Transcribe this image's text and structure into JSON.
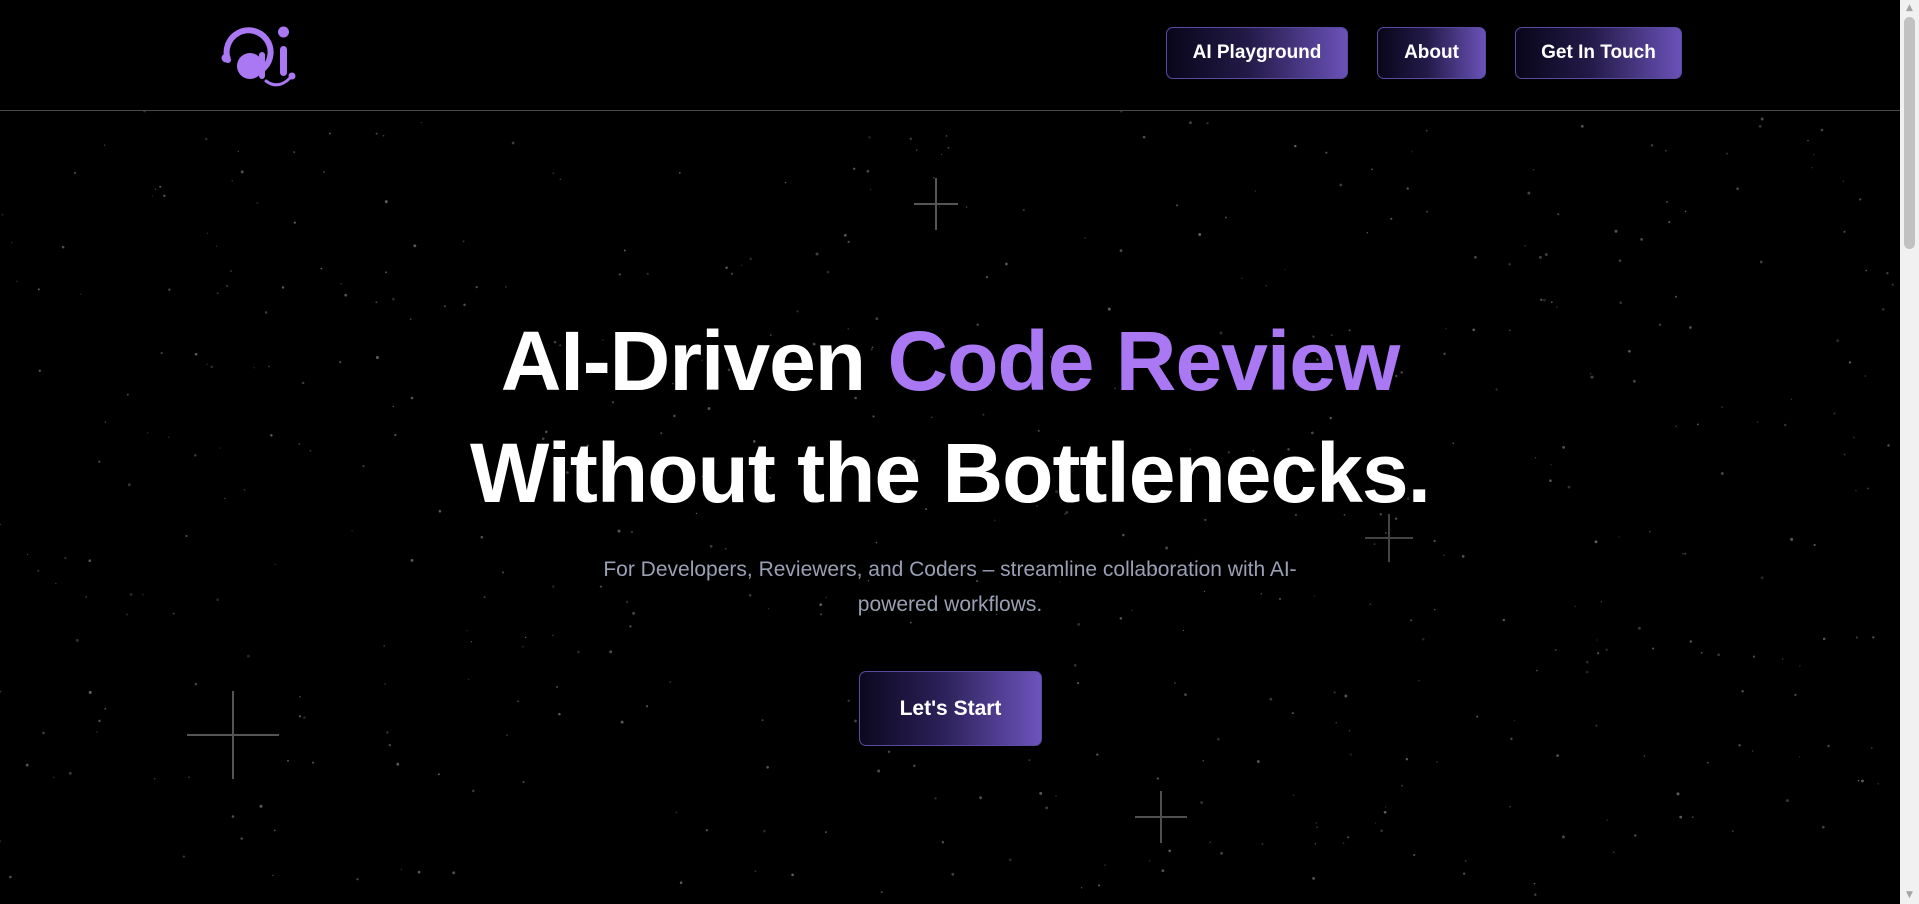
{
  "nav": {
    "logo_icon": "ai-logo-icon",
    "links": [
      {
        "label": "AI Playground"
      },
      {
        "label": "About"
      },
      {
        "label": "Get In Touch"
      }
    ]
  },
  "hero": {
    "title_part1": "AI-Driven ",
    "title_accent": "Code Review",
    "title_line2": "Without the Bottlenecks.",
    "subtitle": "For Developers, Reviewers, and Coders – streamline collaboration with AI-powered workflows.",
    "cta_label": "Let's Start"
  },
  "colors": {
    "background": "#000000",
    "accent": "#a978f2",
    "button_gradient_end": "#6a52b8",
    "subtitle": "#9aa0b4"
  }
}
